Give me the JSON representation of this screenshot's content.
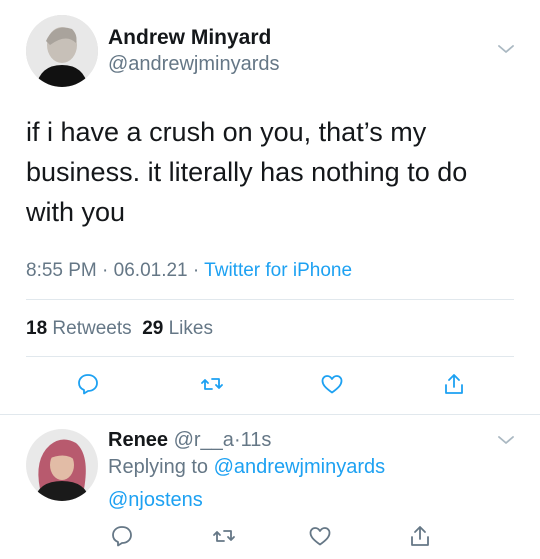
{
  "tweet": {
    "author_name": "Andrew Minyard",
    "author_handle": "@andrewjminyards",
    "text": "if i have a crush on you, that’s my business. it literally has nothing to do with you",
    "time": "8:55 PM",
    "sep1": " · ",
    "date": "06.01.21",
    "sep2": " · ",
    "source": "Twitter for iPhone",
    "retweet_count": "18",
    "retweet_label": "Retweets",
    "like_count": "29",
    "like_label": "Likes"
  },
  "reply": {
    "name": "Renee",
    "handle": "@r__a",
    "dot": "·",
    "time": "11s",
    "replying_prefix": "Replying to",
    "replying_to": "@andrewjminyards",
    "text": "@njostens"
  },
  "icons": {
    "reply": "reply-icon",
    "retweet": "retweet-icon",
    "like": "heart-icon",
    "share": "share-icon",
    "more": "chevron-down-icon"
  },
  "colors": {
    "accent": "#1da1f2",
    "secondary_text": "#657786",
    "primary_text": "#14171a",
    "divider": "#e1e8ed"
  }
}
